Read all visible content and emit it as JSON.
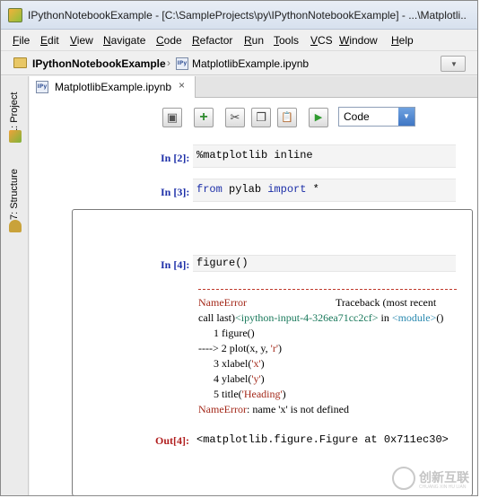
{
  "window": {
    "title": "IPythonNotebookExample - [C:\\SampleProjects\\py\\IPythonNotebookExample] - ...\\Matplotli..."
  },
  "menu": [
    "File",
    "Edit",
    "View",
    "Navigate",
    "Code",
    "Refactor",
    "Run",
    "Tools",
    "VCS",
    "Window",
    "Help"
  ],
  "navbar": {
    "project": "IPythonNotebookExample",
    "separator": "›",
    "file": "MatplotlibExample.ipynb",
    "dropdown_glyph": "▼"
  },
  "left_strip": {
    "project_tab": "1: Project",
    "structure_tab": "7: Structure"
  },
  "editor_tab": {
    "label": "MatplotlibExample.ipynb",
    "close_glyph": "×",
    "icon_text": "IPy"
  },
  "toolbar": {
    "buttons": [
      {
        "name": "save-icon",
        "glyph": "▣"
      },
      {
        "name": "add-cell-icon",
        "glyph": "+"
      },
      {
        "name": "cut-icon",
        "glyph": "✂"
      },
      {
        "name": "copy-icon",
        "glyph": "❐"
      },
      {
        "name": "paste-icon",
        "glyph": "📋"
      },
      {
        "name": "run-icon",
        "glyph": "▶"
      }
    ],
    "cell_type": "Code",
    "cell_type_arrow": "▼"
  },
  "cells": {
    "c2": {
      "prompt": "In [2]:",
      "code": "%matplotlib inline"
    },
    "c3": {
      "prompt": "In [3]:",
      "code_kw1": "from",
      "code_mid": " pylab ",
      "code_kw2": "import",
      "code_tail": " *"
    },
    "c4": {
      "prompt": "In [4]:",
      "code": "figure()"
    }
  },
  "traceback": {
    "error_name": "NameError",
    "header_right": "Traceback (most recent",
    "call_last": "call last)",
    "input_ref": "<ipython-input-4-326ea71cc2cf>",
    "in_word": " in ",
    "module_ref": "<module>",
    "module_tail": "()",
    "lines": [
      {
        "prefix": "      1 ",
        "text": "figure()"
      },
      {
        "prefix": "----> 2 ",
        "text": "plot(x, y, 'r')"
      },
      {
        "prefix": "      3 ",
        "text": "xlabel('x')"
      },
      {
        "prefix": "      4 ",
        "text": "ylabel('y')"
      },
      {
        "prefix": "      5 ",
        "text": "title('Heading')"
      }
    ],
    "final_error": "NameError",
    "final_message": ": name 'x' is not defined"
  },
  "output": {
    "prompt": "Out[4]:",
    "text": "<matplotlib.figure.Figure at 0x711ec30>"
  },
  "watermark": {
    "title": "创新互联",
    "subtitle": "CHUANG XIN HU LIAN"
  }
}
